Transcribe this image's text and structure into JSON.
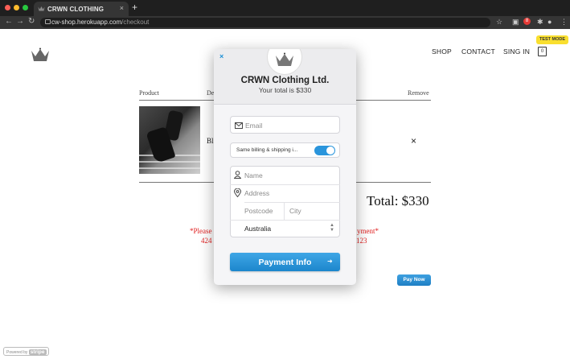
{
  "browser": {
    "tab_title": "CRWN CLOTHING",
    "tab_close": "×",
    "new_tab": "+",
    "url_host": "cw-shop.herokuapp.com",
    "url_path": "/checkout",
    "ext_badge": "8"
  },
  "header": {
    "nav": [
      "SHOP",
      "CONTACT",
      "SING IN"
    ],
    "bag_count": "0",
    "test_mode": "TEST MODE"
  },
  "checkout": {
    "col_product": "Product",
    "col_description_partial": "De",
    "col_remove": "Remove",
    "item_name_partial": "Bl",
    "remove_symbol": "×",
    "total": "Total: $330",
    "warning_line1_left": "*Please",
    "warning_line1_right": "yment*",
    "warning_line2_left": "424",
    "warning_line2_right": "123",
    "pay_now": "Pay Now",
    "powered_by": "Powered by",
    "powered_brand": "stripe"
  },
  "modal": {
    "close": "×",
    "title": "CRWN Clothing Ltd.",
    "subtitle": "Your total is $330",
    "email_placeholder": "Email",
    "same_billing_label": "Same billing & shipping i...",
    "name_placeholder": "Name",
    "address_placeholder": "Address",
    "postcode_placeholder": "Postcode",
    "city_placeholder": "City",
    "country_value": "Australia",
    "pay_button": "Payment Info",
    "pay_arrow": "➜"
  },
  "colors": {
    "accent": "#1c86cc",
    "warning": "#e02020",
    "test_mode_bg": "#f9df2f"
  }
}
